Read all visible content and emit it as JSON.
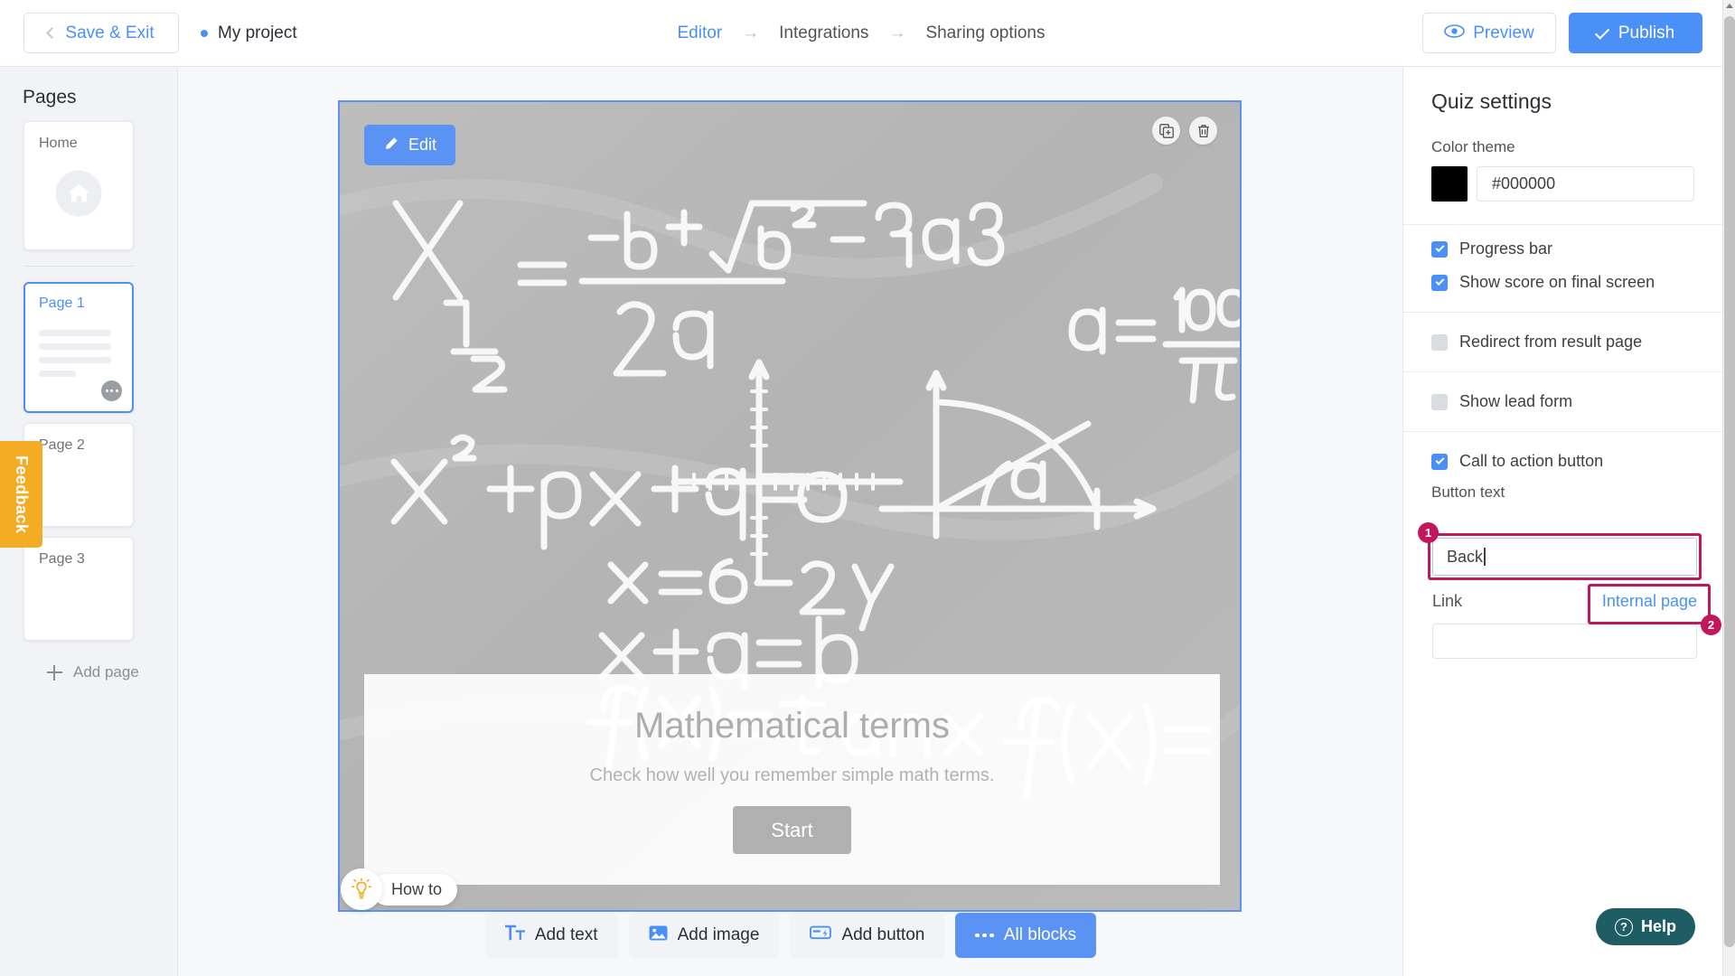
{
  "topbar": {
    "save_exit_label": "Save & Exit",
    "project_title": "My project",
    "breadcrumbs": [
      {
        "label": "Editor",
        "active": true
      },
      {
        "label": "Integrations",
        "active": false
      },
      {
        "label": "Sharing options",
        "active": false
      }
    ],
    "arrow_glyph": "→",
    "preview_label": "Preview",
    "publish_label": "Publish"
  },
  "sidebar": {
    "title": "Pages",
    "pages": [
      {
        "label": "Home",
        "type": "home",
        "selected": false
      },
      {
        "label": "Page 1",
        "type": "content",
        "selected": true
      },
      {
        "label": "Page 2",
        "type": "blank",
        "selected": false
      },
      {
        "label": "Page 3",
        "type": "blank",
        "selected": false
      }
    ],
    "add_page_label": "Add page",
    "feedback_label": "Feedback"
  },
  "canvas": {
    "edit_label": "Edit",
    "duplicate_icon": "duplicate-icon",
    "delete_icon": "trash-icon",
    "hero": {
      "title": "Mathematical terms",
      "subtitle": "Check how well you remember simple math terms.",
      "start_label": "Start"
    },
    "background_alt": "chalkboard with math formulas",
    "howto_label": "How to",
    "toolbar": [
      {
        "label": "Add text",
        "icon": "text-icon",
        "primary": false
      },
      {
        "label": "Add image",
        "icon": "image-icon",
        "primary": false
      },
      {
        "label": "Add button",
        "icon": "button-icon",
        "primary": false
      },
      {
        "label": "All blocks",
        "icon": "ellipsis-icon",
        "primary": true
      }
    ]
  },
  "right_panel": {
    "title": "Quiz settings",
    "color_theme_label": "Color theme",
    "color_theme_value": "#000000",
    "color_swatch_hex": "#000000",
    "options": [
      {
        "label": "Progress bar",
        "checked": true
      },
      {
        "label": "Show score on final screen",
        "checked": true
      },
      {
        "label": "Redirect from result page",
        "checked": false
      },
      {
        "label": "Show lead form",
        "checked": false
      },
      {
        "label": "Call to action button",
        "checked": true
      }
    ],
    "button_text_label": "Button text",
    "button_text_value": "Back",
    "link_label": "Link",
    "link_value": "Internal page",
    "link_input_value": ""
  },
  "annotations": [
    {
      "number": "1",
      "target": "button-text-field"
    },
    {
      "number": "2",
      "target": "link-type-value"
    }
  ],
  "help": {
    "label": "Help",
    "icon": "question-icon",
    "color": "#1d5d63"
  },
  "accent_colors": {
    "primary_blue": "#4a90f7",
    "annotation_pink": "#c2185b",
    "feedback_orange": "#f5ac25",
    "help_teal": "#1d5d63"
  }
}
